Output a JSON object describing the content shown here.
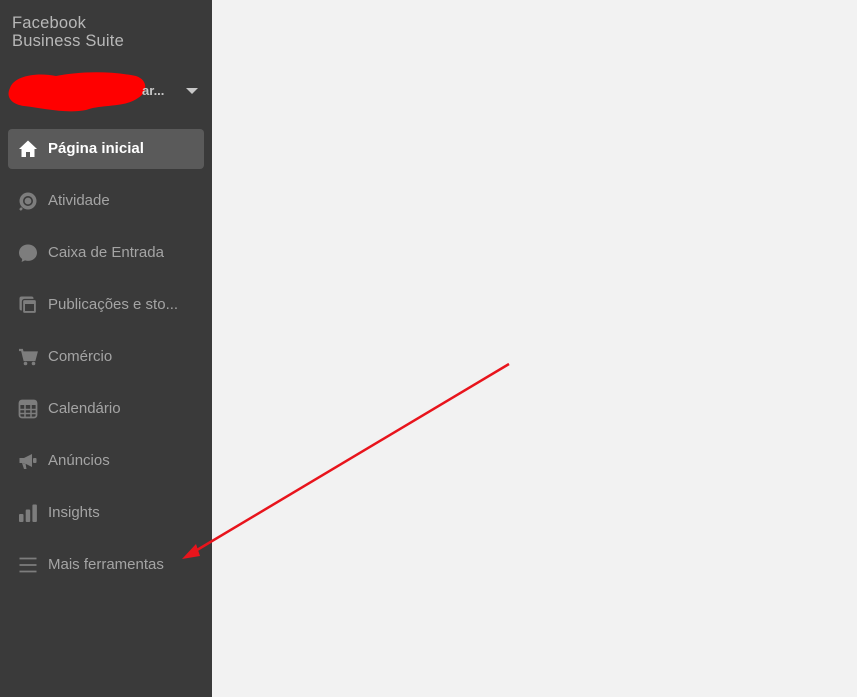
{
  "app": {
    "brand_line1": "Facebook",
    "brand_line2": "Business Suite"
  },
  "account": {
    "name_visible": "ar...",
    "redacted": true
  },
  "nav": {
    "items": [
      {
        "label": "Página inicial",
        "icon": "home-icon",
        "active": true
      },
      {
        "label": "Atividade",
        "icon": "activity-icon",
        "active": false
      },
      {
        "label": "Caixa de Entrada",
        "icon": "inbox-icon",
        "active": false
      },
      {
        "label": "Publicações e sto...",
        "icon": "posts-icon",
        "active": false
      },
      {
        "label": "Comércio",
        "icon": "cart-icon",
        "active": false
      },
      {
        "label": "Calendário",
        "icon": "calendar-icon",
        "active": false
      },
      {
        "label": "Anúncios",
        "icon": "megaphone-icon",
        "active": false
      },
      {
        "label": "Insights",
        "icon": "insights-icon",
        "active": false
      },
      {
        "label": "Mais ferramentas",
        "icon": "menu-icon",
        "active": false
      }
    ]
  },
  "colors": {
    "sidebar_bg": "#3a3a3a",
    "active_item_bg": "#5a5a5a",
    "content_bg": "#f2f2f2",
    "annotation_arrow": "#e8141c",
    "redaction": "#ff0000"
  }
}
